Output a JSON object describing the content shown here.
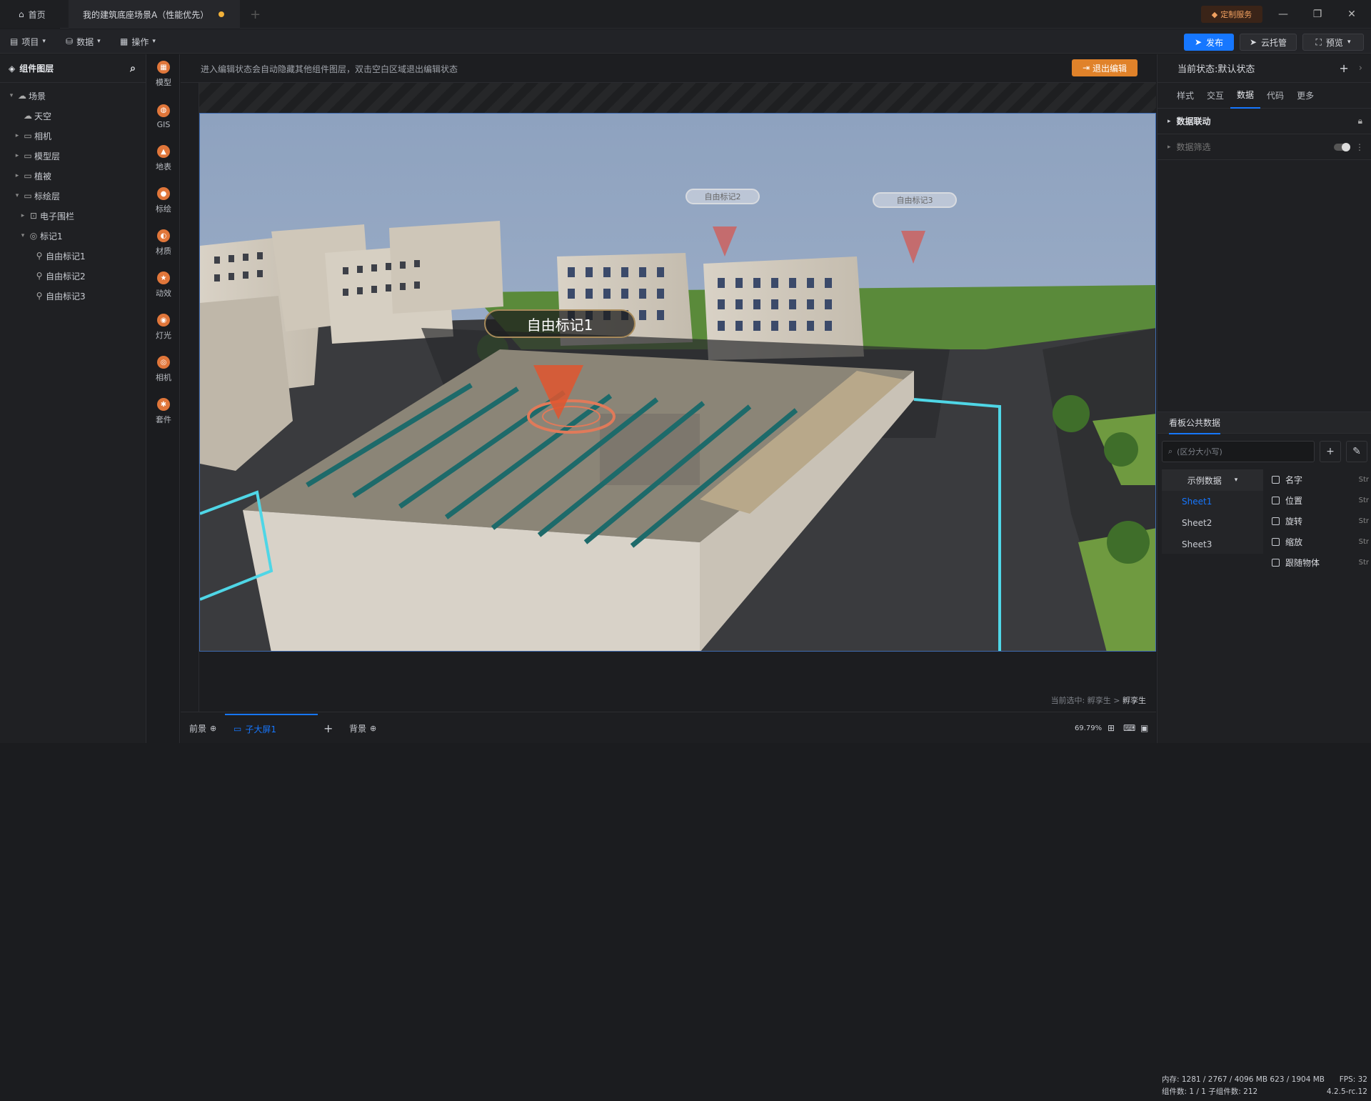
{
  "titlebar": {
    "home": "首页",
    "doc_title": "我的建筑底座场景A（性能优先）",
    "custom_service": "定制服务"
  },
  "toolbar": {
    "project": "项目",
    "data": "数据",
    "operate": "操作",
    "publish": "发布",
    "cloud": "云托管",
    "preview": "预览"
  },
  "left_panel": {
    "title": "组件图层",
    "tree": [
      {
        "label": "场景",
        "indent": 0,
        "arrow": "▾",
        "icon": "☁"
      },
      {
        "label": "天空",
        "indent": 1,
        "arrow": "",
        "icon": "☁"
      },
      {
        "label": "相机",
        "indent": 1,
        "arrow": "▸",
        "icon": "▭"
      },
      {
        "label": "模型层",
        "indent": 1,
        "arrow": "▸",
        "icon": "▭"
      },
      {
        "label": "植被",
        "indent": 1,
        "arrow": "▸",
        "icon": "▭"
      },
      {
        "label": "标绘层",
        "indent": 1,
        "arrow": "▾",
        "icon": "▭"
      },
      {
        "label": "电子围栏",
        "indent": 2,
        "arrow": "▸",
        "icon": "⊡"
      },
      {
        "label": "标记1",
        "indent": 2,
        "arrow": "▾",
        "icon": "◎"
      },
      {
        "label": "自由标记1",
        "indent": 3,
        "arrow": "",
        "icon": "⚲"
      },
      {
        "label": "自由标记2",
        "indent": 3,
        "arrow": "",
        "icon": "⚲"
      },
      {
        "label": "自由标记3",
        "indent": 3,
        "arrow": "",
        "icon": "⚲"
      }
    ]
  },
  "icon_bar": [
    "模型",
    "GIS",
    "地表",
    "标绘",
    "材质",
    "动效",
    "灯光",
    "相机",
    "套件"
  ],
  "canvas": {
    "hint": "进入编辑状态会自动隐藏其他组件图层，双击空白区域退出编辑状态",
    "exit_edit": "退出编辑",
    "selected_prefix": "当前选中:",
    "selected_path": "孵孪生 >",
    "selected_name": "孵孪生"
  },
  "scene": {
    "marker1": "自由标记1",
    "marker2": "自由标记2",
    "marker3": "自由标记3"
  },
  "bottom": {
    "front": "前景",
    "child": "子大屏1",
    "back": "背景",
    "zoom": "69.79%"
  },
  "right_panel": {
    "state": "当前状态:默认状态",
    "tabs": [
      "样式",
      "交互",
      "数据",
      "代码",
      "更多"
    ],
    "active_tab": "数据",
    "data_link": "数据联动",
    "data_filter": "数据筛选"
  },
  "board": {
    "title": "看板公共数据",
    "search_placeholder": "(区分大小写)",
    "dataset": "示例数据",
    "sheets": [
      "Sheet1",
      "Sheet2",
      "Sheet3"
    ],
    "fields": [
      "名字",
      "位置",
      "旋转",
      "缩放",
      "跟随物体"
    ],
    "field_type": "Str"
  },
  "status": {
    "memory": "内存: 1281 / 2767 / 4096 MB  623 / 1904 MB",
    "fps": "FPS: 32",
    "components": "组件数: 1 / 1   子组件数: 212",
    "version": "4.2.5-rc.12"
  },
  "colors": {
    "accent": "#1677ff",
    "orange": "#e0822a",
    "marker": "#e0552e"
  }
}
